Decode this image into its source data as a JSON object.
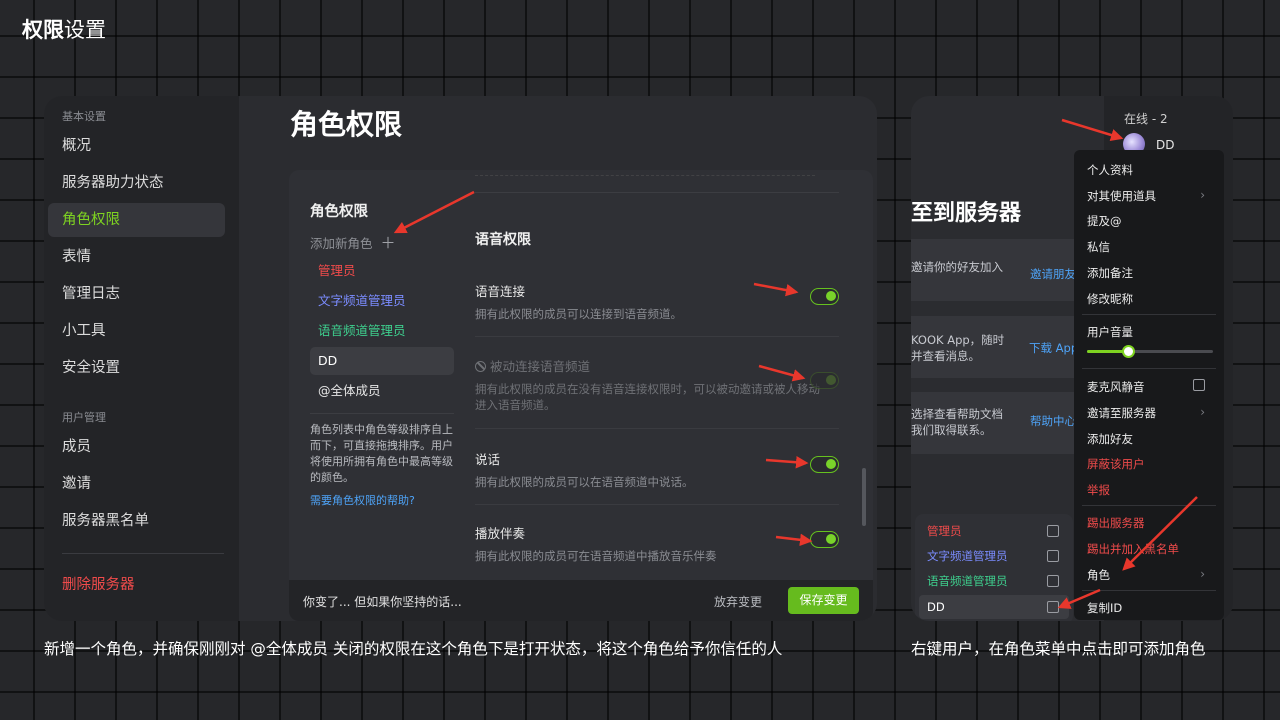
{
  "page": {
    "title_bold": "权限",
    "title_light": "设置",
    "caption_left": "新增一个角色，并确保刚刚对 @全体成员 关闭的权限在这个角色下是打开状态，将这个角色给予你信任的人",
    "caption_right": "右键用户，在角色菜单中点击即可添加角色"
  },
  "sidebar": {
    "section_basic": "基本设置",
    "items_basic": [
      "概况",
      "服务器助力状态",
      "角色权限",
      "表情",
      "管理日志",
      "小工具",
      "安全设置"
    ],
    "section_users": "用户管理",
    "items_users": [
      "成员",
      "邀请",
      "服务器黑名单"
    ],
    "delete_server": "删除服务器"
  },
  "main": {
    "title": "角色权限",
    "roles_title": "角色权限",
    "add_role": "添加新角色",
    "add_role_icon": "plus-icon",
    "roles": [
      {
        "name": "管理员",
        "color": "#f04b4b"
      },
      {
        "name": "文字频道管理员",
        "color": "#7b8cff"
      },
      {
        "name": "语音频道管理员",
        "color": "#3ecf8e"
      },
      {
        "name": "DD",
        "color": "#ffffff"
      },
      {
        "name": "@全体成员",
        "color": "#e6e6e6"
      }
    ],
    "roles_help": "角色列表中角色等级排序自上而下，可直接拖拽排序。用户将使用所拥有角色中最高等级的颜色。",
    "roles_help_link": "需要角色权限的帮助?",
    "voice_section": "语音权限",
    "permissions": [
      {
        "title": "语音连接",
        "desc": "拥有此权限的成员可以连接到语音频道。",
        "enabled": true
      },
      {
        "title": "被动连接语音频道",
        "desc": "拥有此权限的成员在没有语音连接权限时，可以被动邀请或被人移动进入语音频道。",
        "enabled": false
      },
      {
        "title": "说话",
        "desc": "拥有此权限的成员可以在语音频道中说话。",
        "enabled": true
      },
      {
        "title": "播放伴奏",
        "desc": "拥有此权限的成员可在语音频道中播放音乐伴奏",
        "enabled": true
      }
    ],
    "save_bar": {
      "message": "你变了... 但如果你坚持的话...",
      "discard": "放弃变更",
      "save": "保存变更"
    }
  },
  "right": {
    "join_title": "至到服务器",
    "cards": [
      {
        "text1": "邀请你的好友加入",
        "text2": "",
        "link": "邀请朋友"
      },
      {
        "text1": "KOOK App，随时",
        "text2": "并查看消息。",
        "link": "下载 App"
      },
      {
        "text1": "选择查看帮助文档",
        "text2": "我们取得联系。",
        "link": "帮助中心"
      }
    ],
    "online_title": "在线 - 2",
    "user_name": "DD",
    "role_popup": [
      {
        "name": "管理员",
        "color": "#f04b4b"
      },
      {
        "name": "文字频道管理员",
        "color": "#7b8cff"
      },
      {
        "name": "语音频道管理员",
        "color": "#3ecf8e"
      },
      {
        "name": "DD",
        "color": "#ffffff"
      }
    ],
    "context_menu": {
      "profile": "个人资料",
      "use_item": "对其使用道具",
      "mention": "提及@",
      "dm": "私信",
      "add_note": "添加备注",
      "edit_nick": "修改昵称",
      "volume_label": "用户音量",
      "volume_level": 0.33,
      "mute_mic": "麦克风静音",
      "invite_server": "邀请至服务器",
      "add_friend": "添加好友",
      "block": "屏蔽该用户",
      "report": "举报",
      "kick": "踢出服务器",
      "kick_ban": "踢出并加入黑名单",
      "roles": "角色",
      "copy_id": "复制ID"
    }
  },
  "colors": {
    "accent_green": "#7ed321",
    "danger_red": "#f04b4b",
    "link_blue": "#4ea3f7",
    "arrow_red": "#e8372c"
  }
}
